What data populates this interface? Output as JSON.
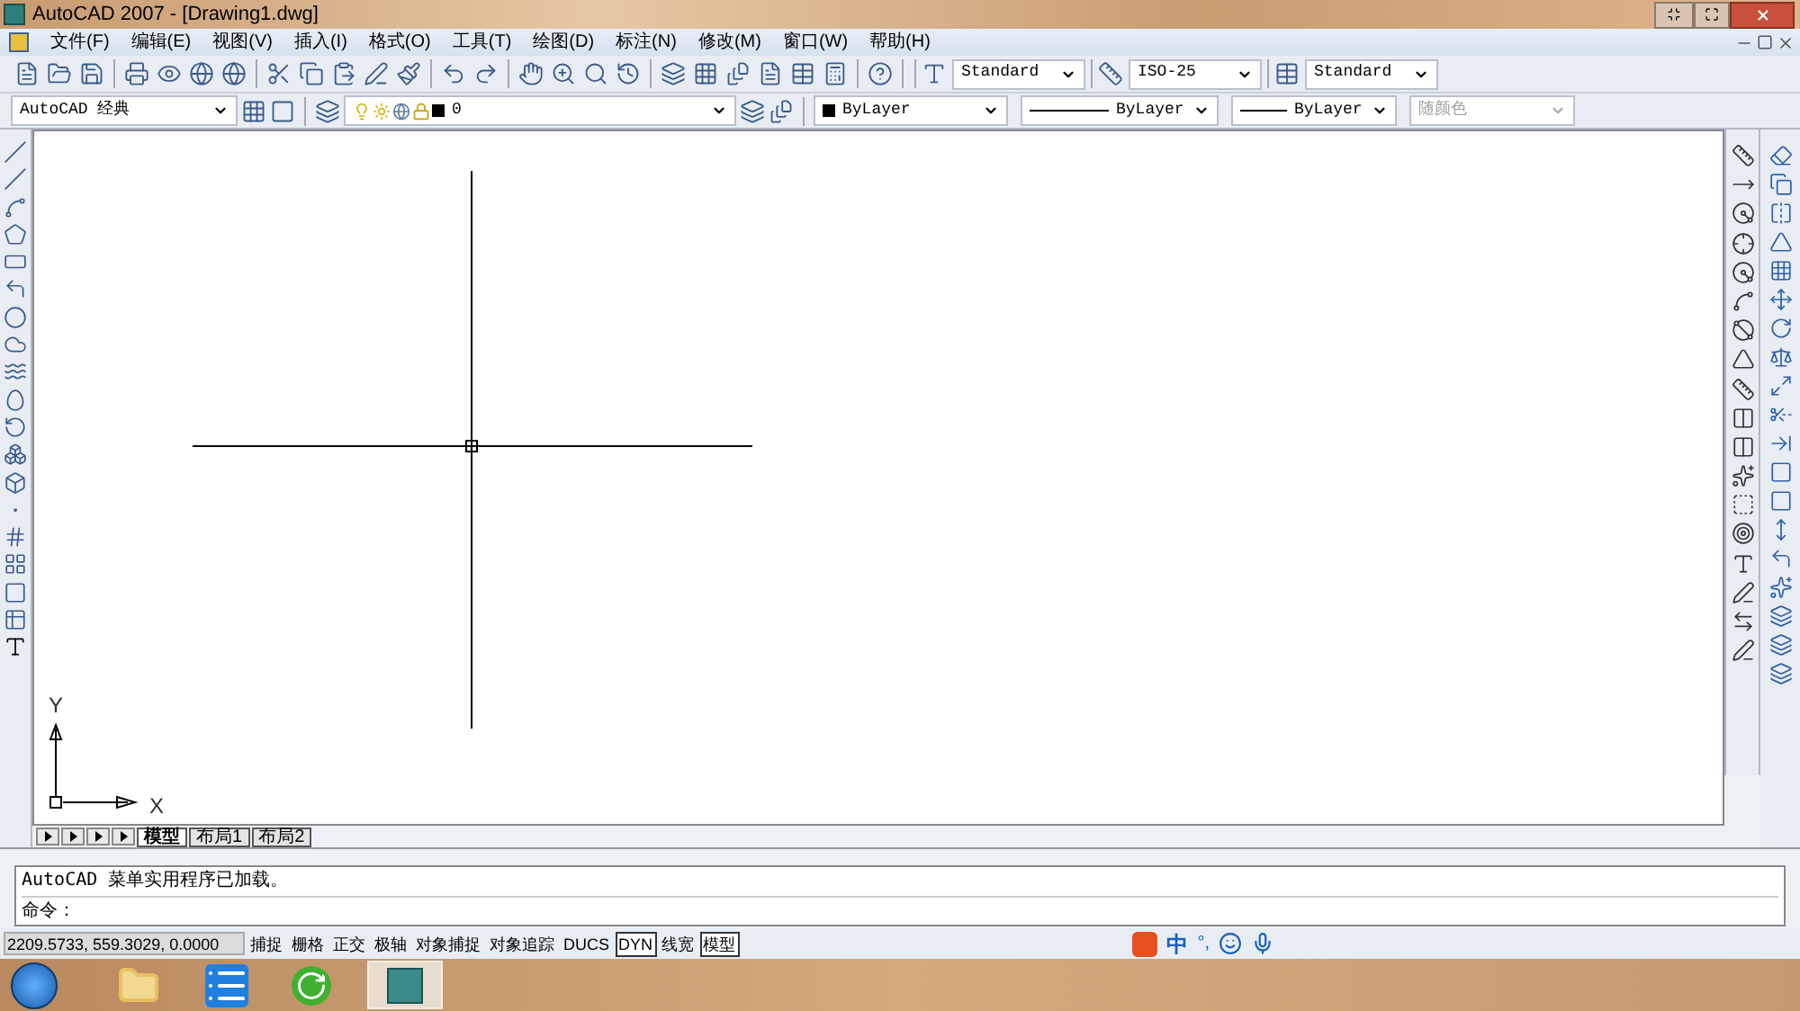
{
  "window": {
    "title": "AutoCAD 2007 - [Drawing1.dwg]"
  },
  "menu": [
    "文件(F)",
    "编辑(E)",
    "视图(V)",
    "插入(I)",
    "格式(O)",
    "工具(T)",
    "绘图(D)",
    "标注(N)",
    "修改(M)",
    "窗口(W)",
    "帮助(H)"
  ],
  "styles_toolbar": {
    "text_style": "Standard",
    "dim_style": "ISO-25",
    "table_style": "Standard"
  },
  "workspace": "AutoCAD 经典",
  "layer": "0",
  "properties": [
    {
      "value": "ByLayer",
      "kind": "color",
      "disabled": false
    },
    {
      "value": "ByLayer",
      "kind": "linetype",
      "disabled": false
    },
    {
      "value": "ByLayer",
      "kind": "lineweight",
      "disabled": false
    },
    {
      "value": "随颜色",
      "kind": "plot",
      "disabled": true
    }
  ],
  "ucs": {
    "x_label": "X",
    "y_label": "Y"
  },
  "layout_tabs": [
    {
      "label": "模型",
      "selected": true
    },
    {
      "label": "布局1",
      "selected": false
    },
    {
      "label": "布局2",
      "selected": false
    }
  ],
  "command": {
    "history": "AutoCAD 菜单实用程序已加载。",
    "prompt": "命令："
  },
  "status_bar": {
    "coordinates": "2209.5733, 559.3029, 0.0000",
    "toggles": [
      {
        "label": "捕捉",
        "on": false
      },
      {
        "label": "栅格",
        "on": false
      },
      {
        "label": "正交",
        "on": false
      },
      {
        "label": "极轴",
        "on": false
      },
      {
        "label": "对象捕捉",
        "on": false
      },
      {
        "label": "对象追踪",
        "on": false
      },
      {
        "label": "DUCS",
        "on": false
      },
      {
        "label": "DYN",
        "on": true
      },
      {
        "label": "线宽",
        "on": false
      },
      {
        "label": "模型",
        "on": true
      }
    ]
  },
  "ime": {
    "mode": "中",
    "punctuation": "°,"
  }
}
